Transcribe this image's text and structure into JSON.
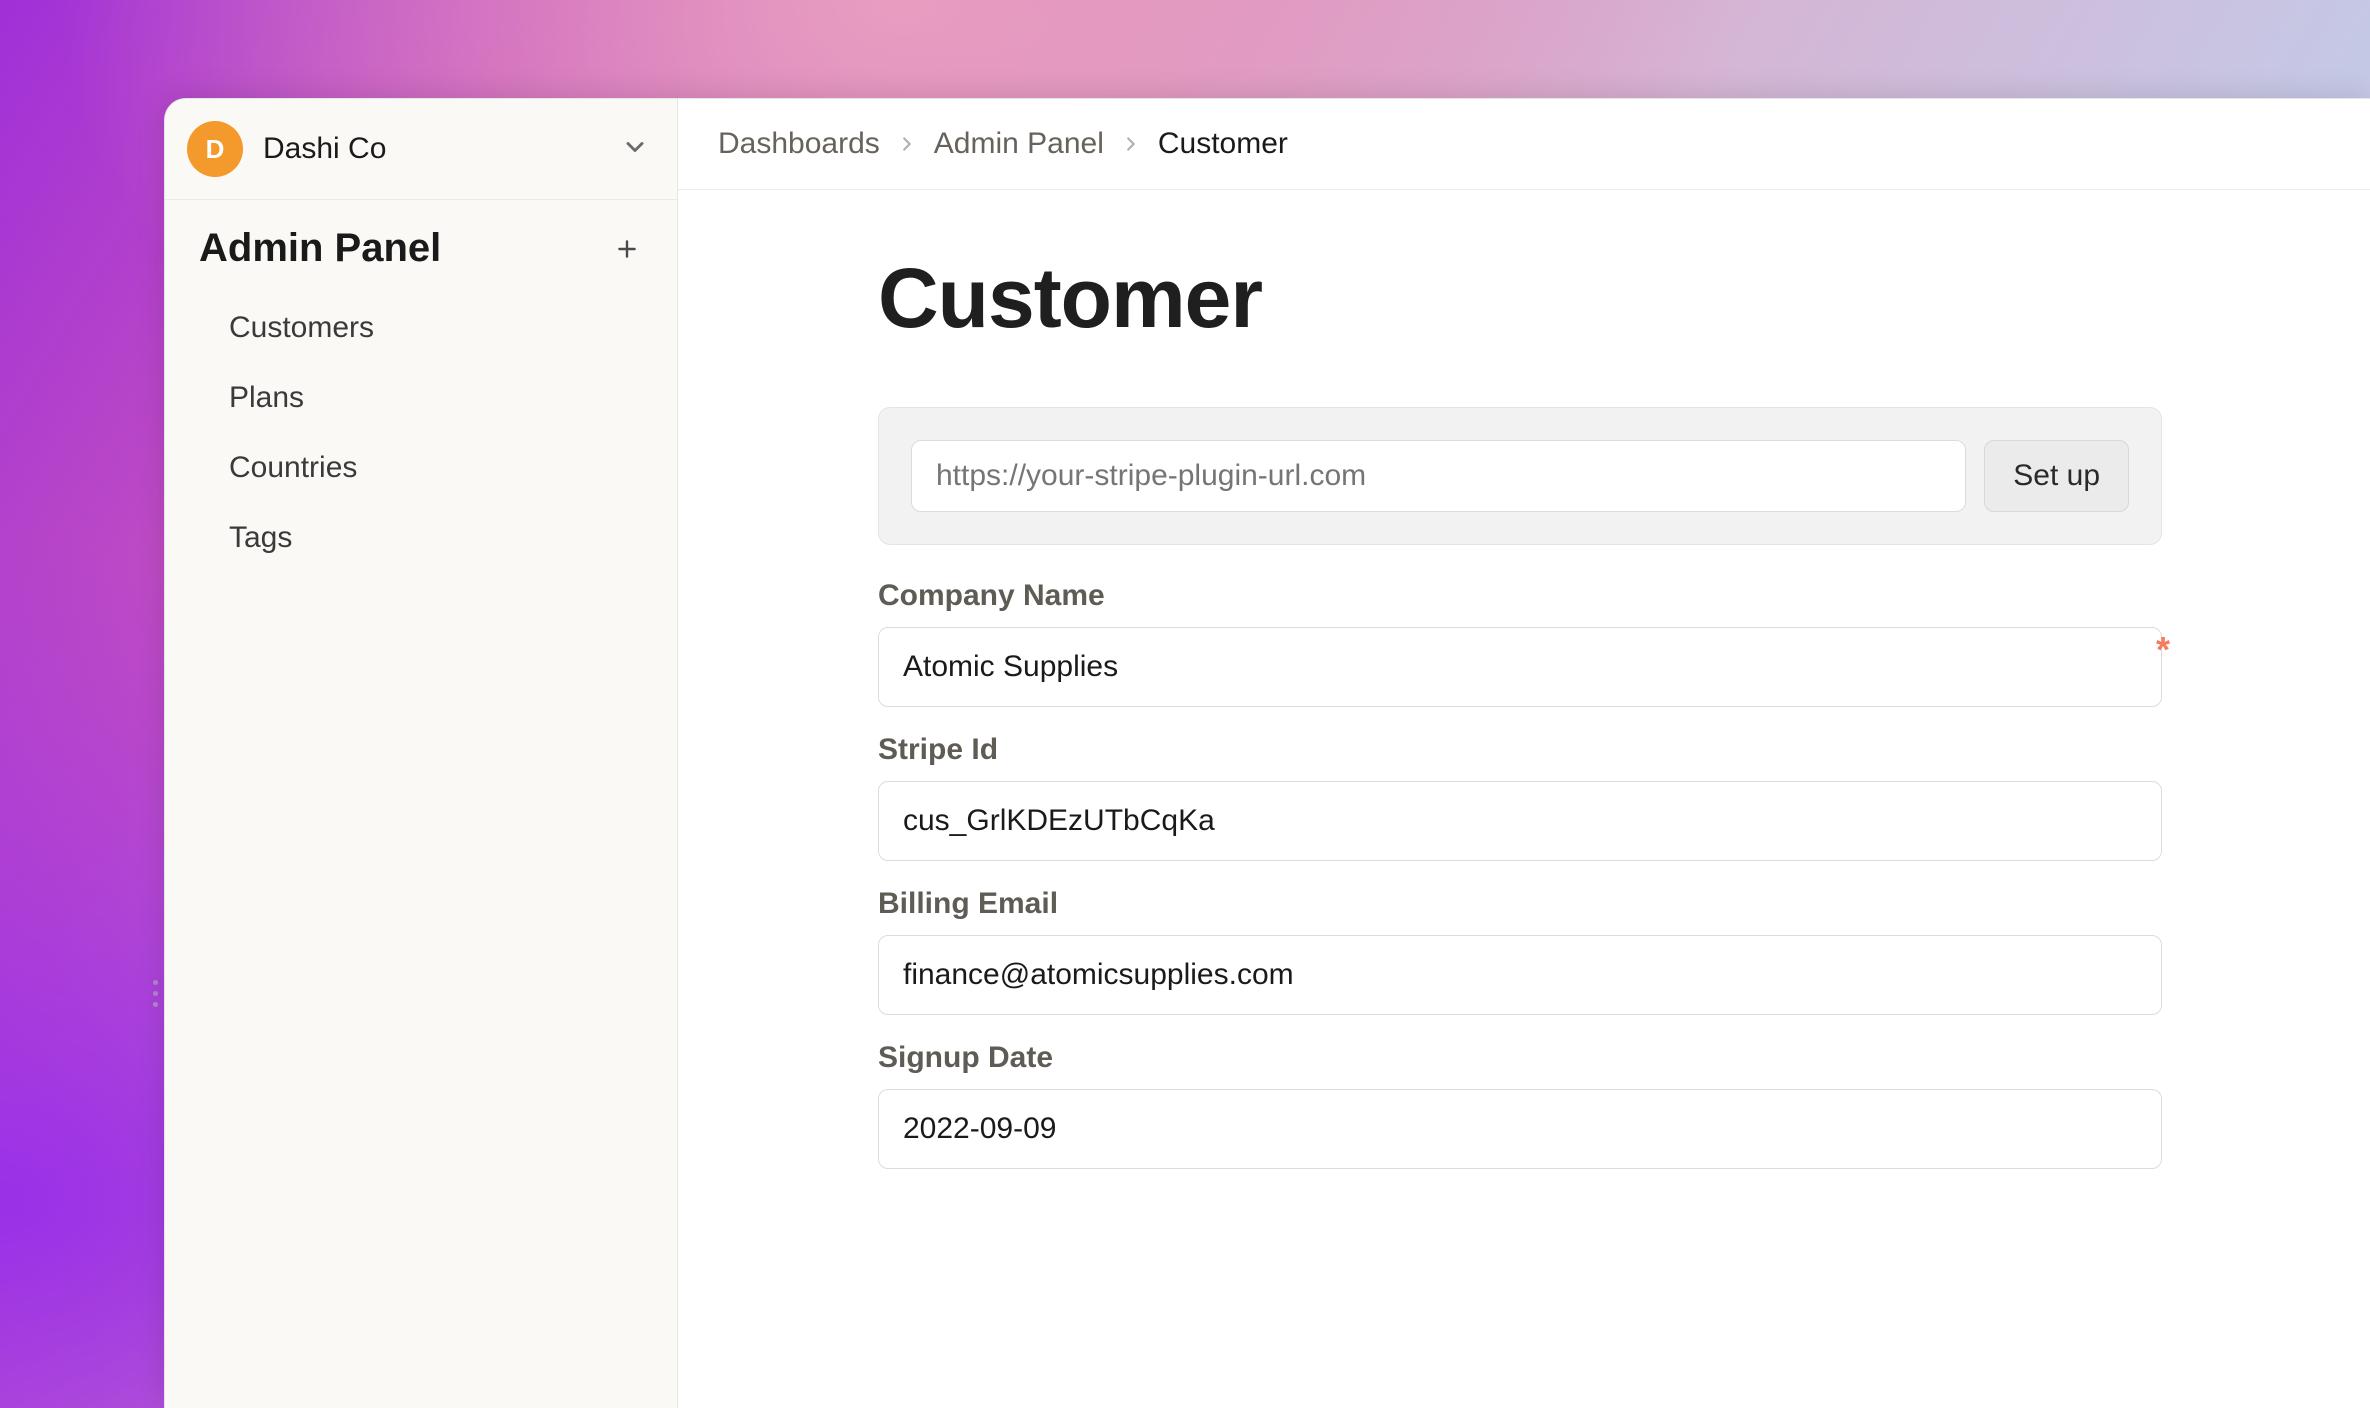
{
  "org": {
    "avatar_initial": "D",
    "name": "Dashi Co"
  },
  "sidebar": {
    "section_title": "Admin Panel",
    "items": [
      {
        "label": "Customers"
      },
      {
        "label": "Plans"
      },
      {
        "label": "Countries"
      },
      {
        "label": "Tags"
      }
    ]
  },
  "breadcrumbs": {
    "items": [
      {
        "label": "Dashboards"
      },
      {
        "label": "Admin Panel"
      },
      {
        "label": "Customer"
      }
    ]
  },
  "page": {
    "title": "Customer"
  },
  "url_box": {
    "placeholder": "https://your-stripe-plugin-url.com",
    "button_label": "Set up"
  },
  "form": {
    "company_name": {
      "label": "Company Name",
      "value": "Atomic Supplies",
      "required": true
    },
    "stripe_id": {
      "label": "Stripe Id",
      "value": "cus_GrlKDEzUTbCqKa"
    },
    "billing_email": {
      "label": "Billing Email",
      "value": "finance@atomicsupplies.com"
    },
    "signup_date": {
      "label": "Signup Date",
      "value": "2022-09-09"
    }
  }
}
